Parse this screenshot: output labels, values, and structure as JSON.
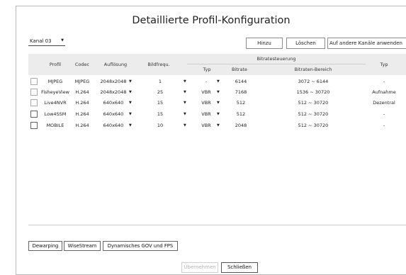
{
  "dialog": {
    "title": "Detaillierte Profil-Konfiguration"
  },
  "channel_select": {
    "value": "Kanal 03",
    "icon": "caret-down-icon"
  },
  "toolbar": {
    "add_label": "Hinzu",
    "delete_label": "Löschen",
    "apply_all_label": "Auf andere Kanäle anwenden"
  },
  "table": {
    "headers": {
      "profile": "Profil",
      "codec": "Codec",
      "resolution": "Auflösung",
      "framerate": "Bildfrequ.",
      "bitrate_control": "Bitratesteuerung",
      "bitrate_type": "Typ",
      "bitrate": "Bitrate",
      "bitrate_range": "Bitraten-Bereich",
      "type": "Typ"
    },
    "rows": [
      {
        "profile": "MJPEG",
        "codec": "MJPEG",
        "resolution": "2048x2048",
        "framerate": "1",
        "bitrate_type": "-",
        "bitrate": "6144",
        "range": "3072 ~ 6144",
        "type": "-"
      },
      {
        "profile": "FisheyeView",
        "codec": "H.264",
        "resolution": "2048x2048",
        "framerate": "25",
        "bitrate_type": "VBR",
        "bitrate": "7168",
        "range": "1536 ~ 30720",
        "type": "Aufnahme"
      },
      {
        "profile": "Live4NVR",
        "codec": "H.264",
        "resolution": "640x640",
        "framerate": "15",
        "bitrate_type": "VBR",
        "bitrate": "512",
        "range": "512 ~ 30720",
        "type": "Dezentral"
      },
      {
        "profile": "Low4SSM",
        "codec": "H.264",
        "resolution": "640x640",
        "framerate": "15",
        "bitrate_type": "VBR",
        "bitrate": "512",
        "range": "512 ~ 30720",
        "type": "-"
      },
      {
        "profile": "MOBILE",
        "codec": "H.264",
        "resolution": "640x640",
        "framerate": "10",
        "bitrate_type": "VBR",
        "bitrate": "2048",
        "range": "512 ~ 30720",
        "type": "-"
      }
    ],
    "dropdown_icon": "caret-down-icon"
  },
  "bottom_buttons": {
    "dewarping": "Dewarping",
    "wisestream": "WiseStream",
    "dynamic_gov": "Dynamisches GOV und FPS"
  },
  "footer": {
    "apply_label": "Übernehmen",
    "close_label": "Schließen"
  }
}
